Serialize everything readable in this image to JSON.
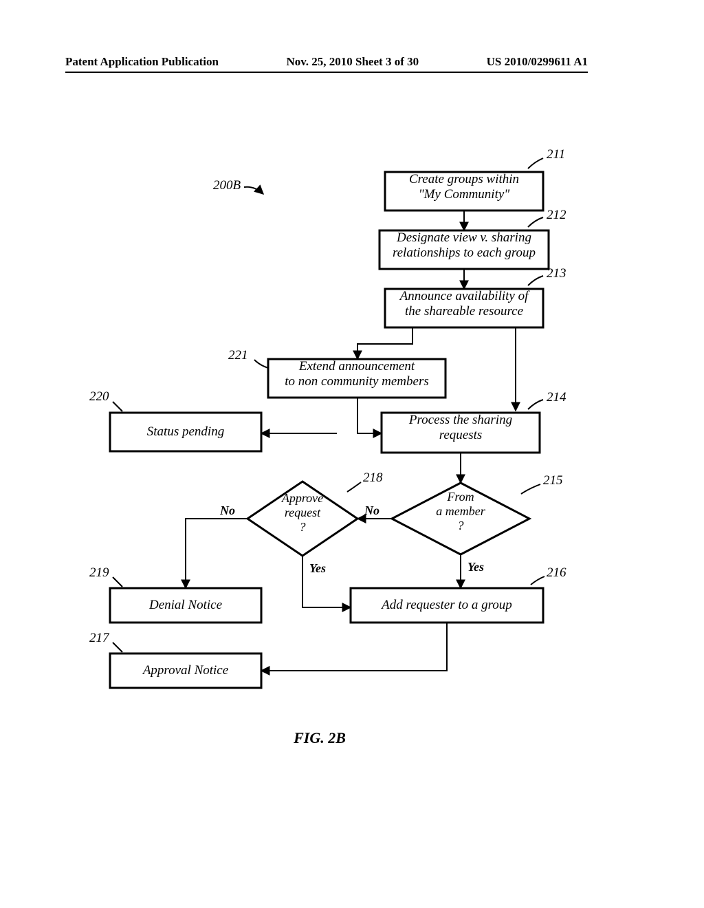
{
  "header": {
    "left": "Patent Application Publication",
    "center": "Nov. 25, 2010  Sheet 3 of 30",
    "right": "US 2010/0299611 A1"
  },
  "figure_label": "200B",
  "nodes": {
    "n211": {
      "num": "211",
      "line1": "Create groups within",
      "line2": "\"My Community\""
    },
    "n212": {
      "num": "212",
      "line1": "Designate view v. sharing",
      "line2": "relationships to each group"
    },
    "n213": {
      "num": "213",
      "line1": "Announce availability of",
      "line2": "the shareable resource"
    },
    "n221": {
      "num": "221",
      "line1": "Extend announcement",
      "line2": "to non community members"
    },
    "n220": {
      "num": "220",
      "line1": "Status pending"
    },
    "n214": {
      "num": "214",
      "line1": "Process the sharing",
      "line2": "requests"
    },
    "n218": {
      "num": "218",
      "line1": "Approve",
      "line2": "request",
      "line3": "?"
    },
    "n215": {
      "num": "215",
      "line1": "From",
      "line2": "a member",
      "line3": "?"
    },
    "n219": {
      "num": "219",
      "line1": "Denial Notice"
    },
    "n216": {
      "num": "216",
      "line1": "Add requester to a group"
    },
    "n217": {
      "num": "217",
      "line1": "Approval Notice"
    }
  },
  "branches": {
    "no": "No",
    "yes": "Yes"
  },
  "caption": "FIG. 2B"
}
